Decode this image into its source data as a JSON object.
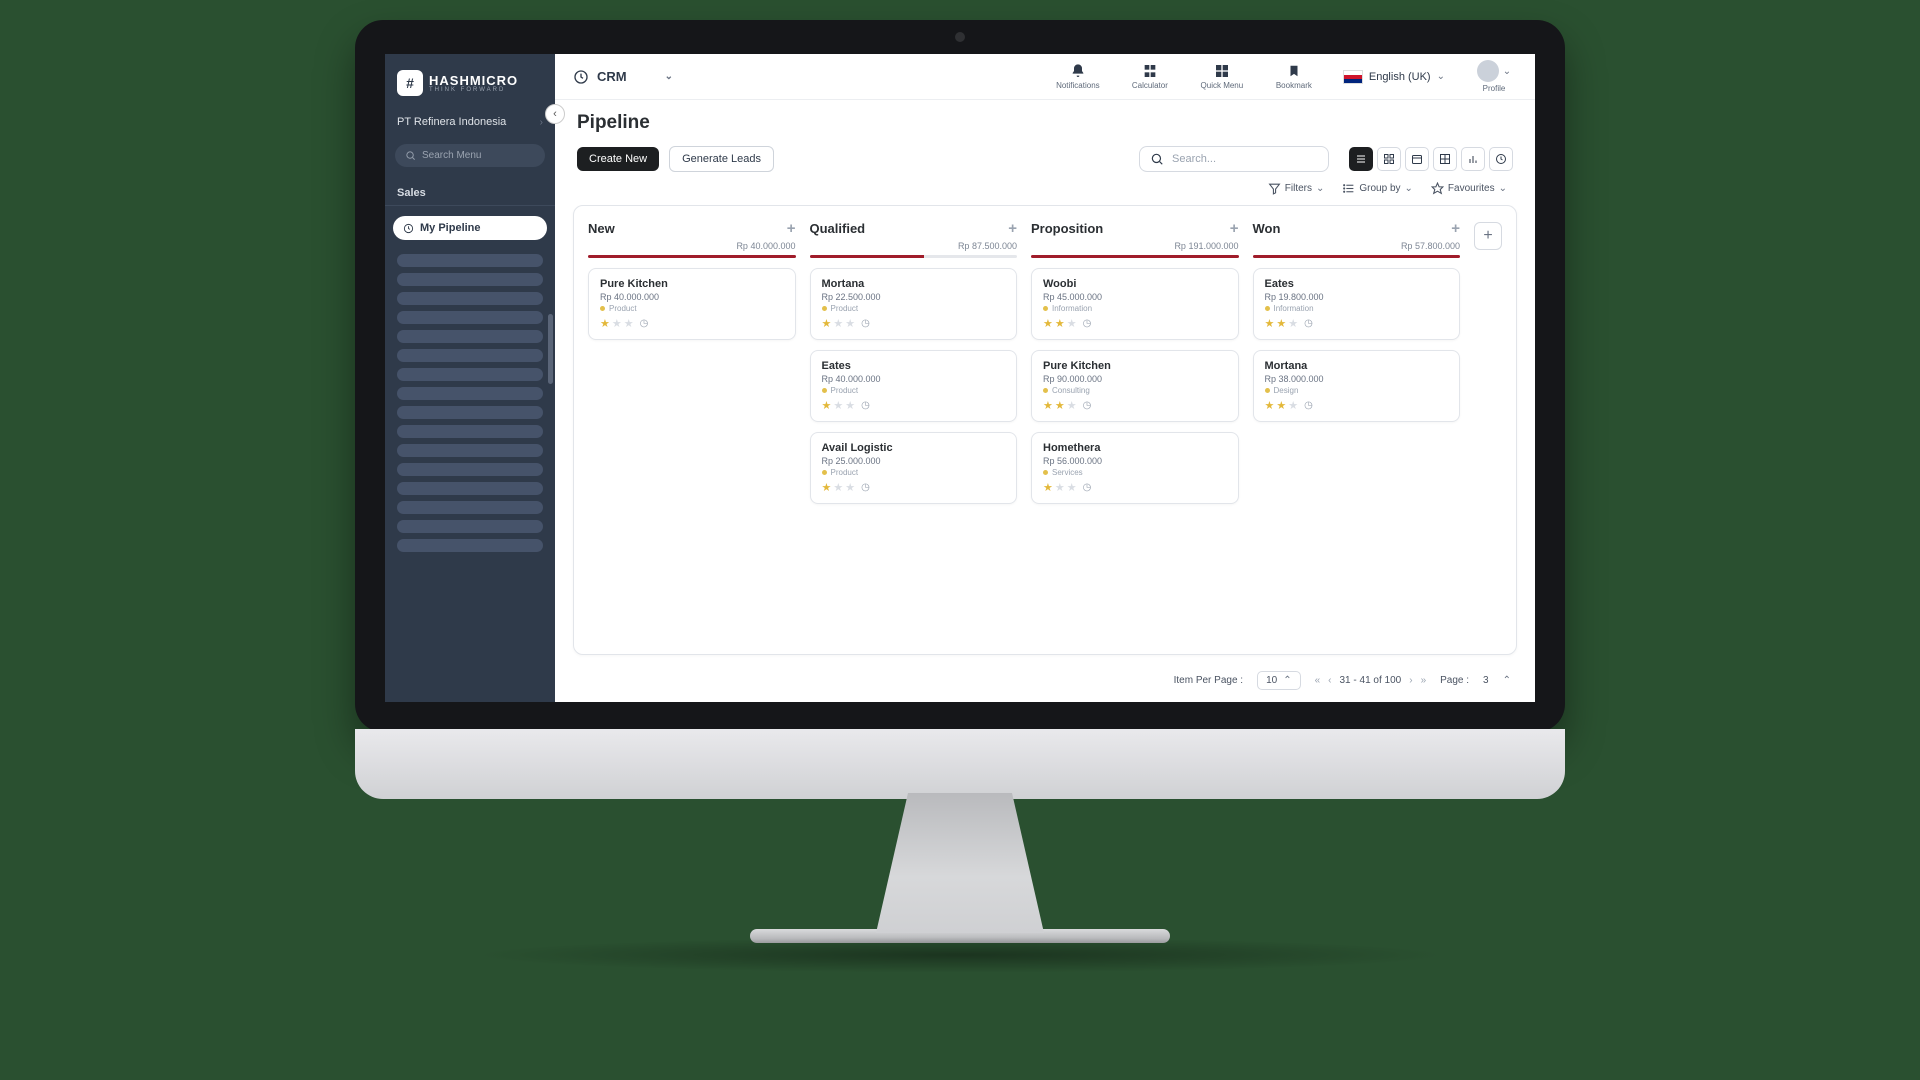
{
  "brand": {
    "name": "HASHMICRO",
    "tagline": "THINK FORWARD"
  },
  "company": "PT Refinera Indonesia",
  "search_menu_placeholder": "Search Menu",
  "sidebar": {
    "section": "Sales",
    "active_item": "My Pipeline"
  },
  "module": "CRM",
  "topbar": {
    "notifications": "Notifications",
    "calculator": "Calculator",
    "quickmenu": "Quick Menu",
    "bookmark": "Bookmark",
    "language": "English (UK)",
    "profile": "Profile"
  },
  "page_title": "Pipeline",
  "buttons": {
    "create": "Create New",
    "generate": "Generate Leads"
  },
  "search_placeholder": "Search...",
  "toolbar": {
    "filters": "Filters",
    "groupby": "Group by",
    "favourites": "Favourites"
  },
  "columns": [
    {
      "name": "New",
      "total": "Rp 40.000.000",
      "fill": 100,
      "cards": [
        {
          "title": "Pure Kitchen",
          "amount": "Rp 40.000.000",
          "tag": "Product",
          "stars": 1
        }
      ]
    },
    {
      "name": "Qualified",
      "total": "Rp 87.500.000",
      "fill": 55,
      "cards": [
        {
          "title": "Mortana",
          "amount": "Rp 22.500.000",
          "tag": "Product",
          "stars": 1
        },
        {
          "title": "Eates",
          "amount": "Rp 40.000.000",
          "tag": "Product",
          "stars": 1
        },
        {
          "title": "Avail Logistic",
          "amount": "Rp 25.000.000",
          "tag": "Product",
          "stars": 1
        }
      ]
    },
    {
      "name": "Proposition",
      "total": "Rp 191.000.000",
      "fill": 100,
      "cards": [
        {
          "title": "Woobi",
          "amount": "Rp 45.000.000",
          "tag": "Information",
          "stars": 2
        },
        {
          "title": "Pure Kitchen",
          "amount": "Rp 90.000.000",
          "tag": "Consulting",
          "stars": 2
        },
        {
          "title": "Homethera",
          "amount": "Rp 56.000.000",
          "tag": "Services",
          "stars": 1
        }
      ]
    },
    {
      "name": "Won",
      "total": "Rp 57.800.000",
      "fill": 100,
      "cards": [
        {
          "title": "Eates",
          "amount": "Rp 19.800.000",
          "tag": "Information",
          "stars": 2
        },
        {
          "title": "Mortana",
          "amount": "Rp 38.000.000",
          "tag": "Design",
          "stars": 2
        }
      ]
    }
  ],
  "footer": {
    "per_page_label": "Item Per Page :",
    "per_page_value": "10",
    "range": "31  -  41 of 100",
    "page_label": "Page :",
    "page_value": "3"
  }
}
